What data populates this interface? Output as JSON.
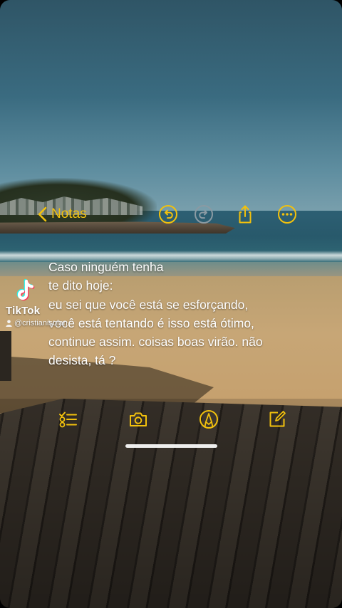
{
  "app": {
    "back_label": "Notas",
    "accent_color": "#f2c10d"
  },
  "toolbar": {
    "icons": [
      "chevron-left-icon",
      "undo-icon",
      "redo-icon",
      "share-icon",
      "more-icon"
    ],
    "redo_enabled": false
  },
  "note": {
    "lines": [
      "Caso ninguém tenha",
      "te dito hoje:",
      "eu sei que você está se esforçando,",
      "você está tentando é isso está ótimo,",
      "continue assim. coisas boas virão. não",
      "desista, tá ?"
    ]
  },
  "bottom_toolbar": {
    "icons": [
      "checklist-icon",
      "camera-icon",
      "markup-pen-icon",
      "compose-icon"
    ]
  },
  "watermark": {
    "brand": "TikTok",
    "username": "@cristianisolan"
  }
}
